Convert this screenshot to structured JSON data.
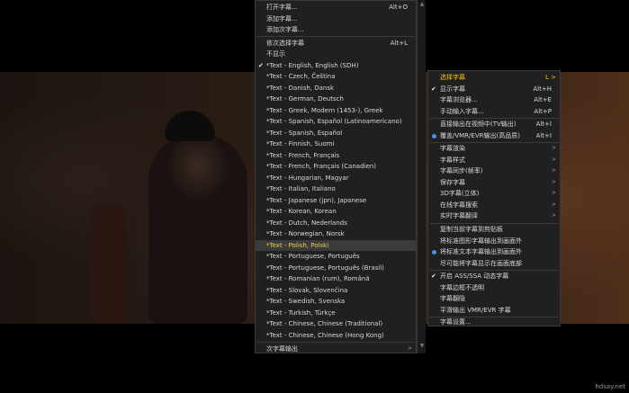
{
  "main_menu": {
    "items": [
      {
        "label": "打开字幕...",
        "shortcut": "Alt+O"
      },
      {
        "label": "添加字幕..."
      },
      {
        "label": "添加次字幕..."
      },
      {
        "label": "依次选择字幕",
        "shortcut": "Alt+L"
      },
      {
        "label": "不显示"
      },
      {
        "label": "*Text - English, English (SDH)",
        "checked": true
      },
      {
        "label": "*Text - Czech, Čeština"
      },
      {
        "label": "*Text - Danish, Dansk"
      },
      {
        "label": "*Text - German, Deutsch"
      },
      {
        "label": "*Text - Greek, Modern (1453-), Greek"
      },
      {
        "label": "*Text - Spanish, Español (Latinoamericano)"
      },
      {
        "label": "*Text - Spanish, Español"
      },
      {
        "label": "*Text - Finnish, Suomi"
      },
      {
        "label": "*Text - French, Français"
      },
      {
        "label": "*Text - French, Français (Canadien)"
      },
      {
        "label": "*Text - Hungarian, Magyar"
      },
      {
        "label": "*Text - Italian, Italiano"
      },
      {
        "label": "*Text - Japanese (jpn), Japanese"
      },
      {
        "label": "*Text - Korean, Korean"
      },
      {
        "label": "*Text - Dutch, Nederlands"
      },
      {
        "label": "*Text - Norwegian, Norsk"
      },
      {
        "label": "*Text - Polish, Polski"
      },
      {
        "label": "*Text - Portuguese, Português"
      },
      {
        "label": "*Text - Portuguese, Português (Brasil)"
      },
      {
        "label": "*Text - Romanian (rum), Română"
      },
      {
        "label": "*Text - Slovak, Slovenčina"
      },
      {
        "label": "*Text - Swedish, Svenska"
      },
      {
        "label": "*Text - Turkish, Türkçe"
      },
      {
        "label": "*Text - Chinese, Chinese (Traditional)"
      },
      {
        "label": "*Text - Chinese, Chinese (Hong Kong)"
      },
      {
        "label": "次字幕输出"
      }
    ],
    "scroll_up_glyph": "▲",
    "scroll_down_glyph": "▼",
    "submenu_arrow": ">"
  },
  "sub_menu": {
    "items": [
      {
        "label": "选择字幕",
        "shortcut": "L >"
      },
      {
        "label": "显示字幕",
        "shortcut": "Alt+H",
        "checked": true
      },
      {
        "label": "字幕浏览器...",
        "shortcut": "Alt+E"
      },
      {
        "label": "手动输入字幕...",
        "shortcut": "Alt+P"
      },
      {
        "label": "直接输出在视频中(TV输出)",
        "shortcut": "Alt+I"
      },
      {
        "label": "覆盖/VMR/EVR输出(高品质)",
        "shortcut": "Alt+I",
        "radio": true
      },
      {
        "label": "字幕渲染"
      },
      {
        "label": "字幕样式"
      },
      {
        "label": "字幕同步(帧率)"
      },
      {
        "label": "保存字幕"
      },
      {
        "label": "3D字幕(立体)"
      },
      {
        "label": "在线字幕搜索"
      },
      {
        "label": "实时字幕翻译"
      },
      {
        "label": "复制当前字幕到剪贴板"
      },
      {
        "label": "将标准图形字幕输出到画面外"
      },
      {
        "label": "将标准文本字幕输出到画面外",
        "radio": true
      },
      {
        "label": "尽可能将字幕显示在画面底部"
      },
      {
        "label": "开启 ASS/SSA 动态字幕",
        "checked": true
      },
      {
        "label": "字幕边框不透明"
      },
      {
        "label": "字幕翻隐"
      },
      {
        "label": "平滑输出 VMR/EVR 字幕"
      },
      {
        "label": "字幕设置..."
      }
    ],
    "check_glyph": "✔",
    "submenu_arrow": ">"
  },
  "watermark": "hdsay.net",
  "colors": {
    "menu_bg": "#202020",
    "highlight_bg": "#3b3b3b",
    "highlight_text": "#f0d24a",
    "header_text": "#f2c21b",
    "radio_dot": "#4a90e2"
  }
}
